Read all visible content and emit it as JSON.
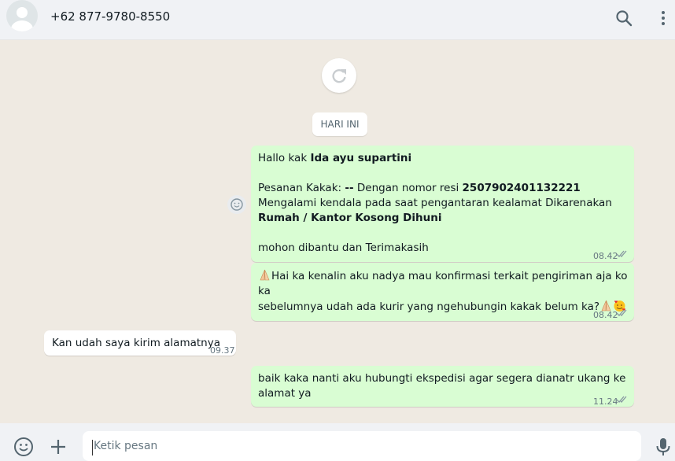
{
  "header": {
    "contact_name": "+62 877-9780-8550"
  },
  "chat": {
    "day_label": "HARI INI",
    "messages": [
      {
        "direction": "out",
        "greeting_prefix": "Hallo kak ",
        "name": "Ida ayu supartini",
        "order_label": "Pesanan Kakak: ",
        "order_dash": "--",
        "text_1": " Dengan nomor resi ",
        "resi": "2507902401132221",
        "text_2": " Mengalami kendala pada saat pengantaran kealamat Dikarenakan ",
        "reason": "Rumah / Kantor Kosong Dihuni",
        "closing": " mohon dibantu dan Terimakasih",
        "time": "08.42"
      },
      {
        "direction": "out",
        "text_a": "Hai ka kenalin aku nadya mau konfirmasi terkait pengiriman aja ko ka",
        "text_b": "sebelumnya udah ada kurir yang ngehubungin kakak belum ka?",
        "time": "08.42"
      },
      {
        "direction": "in",
        "text": "Kan udah saya kirim alamatnya",
        "time": "09.37"
      },
      {
        "direction": "out",
        "text_a": "baik kaka nanti aku hubungti ekspedisi agar segera dianatr ukang ke",
        "text_b": "alamat ya",
        "time": "11.24"
      }
    ]
  },
  "composer": {
    "placeholder": "Ketik pesan"
  },
  "icons": [
    "search-icon",
    "menu-dots-icon",
    "refresh-icon",
    "emoji-icon",
    "plus-icon",
    "mic-icon",
    "double-check-icon",
    "pray-emoji-icon",
    "smiling-hearts-emoji-icon"
  ],
  "colors": {
    "outgoing_bubble": "#d9fdd3",
    "incoming_bubble": "#ffffff",
    "chat_background": "#efeae2",
    "header_background": "#f0f2f5"
  }
}
